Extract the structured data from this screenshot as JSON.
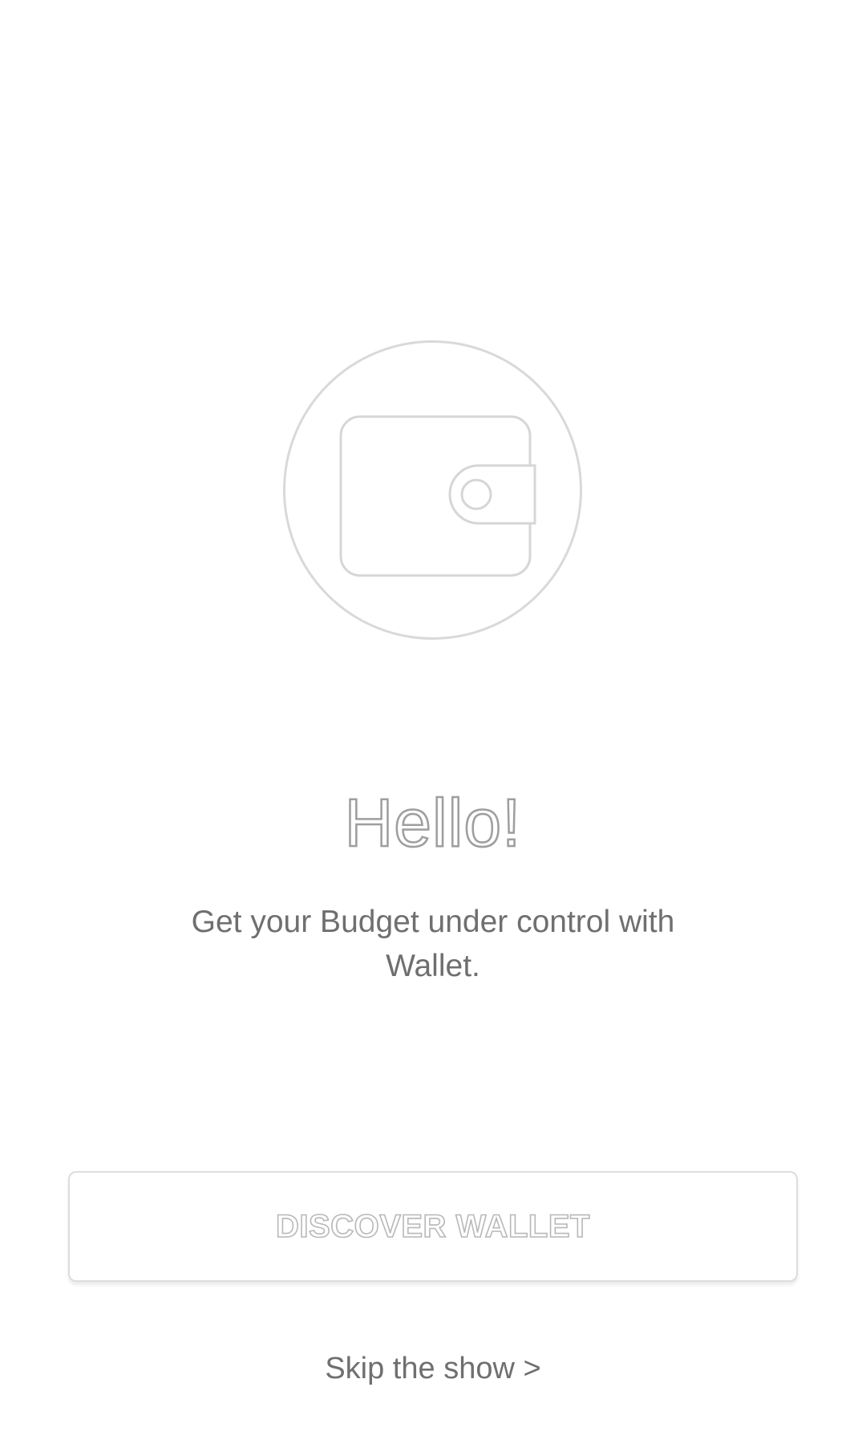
{
  "hero": {
    "icon": "wallet-icon"
  },
  "welcome": {
    "title": "Hello!",
    "subtitle_line1": "Get your Budget under control with",
    "subtitle_line2": "Wallet."
  },
  "actions": {
    "discover_label": "DISCOVER WALLET",
    "skip_label": "Skip the show >"
  },
  "colors": {
    "background": "#ffffff",
    "outline": "#d9d9d9",
    "text": "#6f6f6f"
  }
}
